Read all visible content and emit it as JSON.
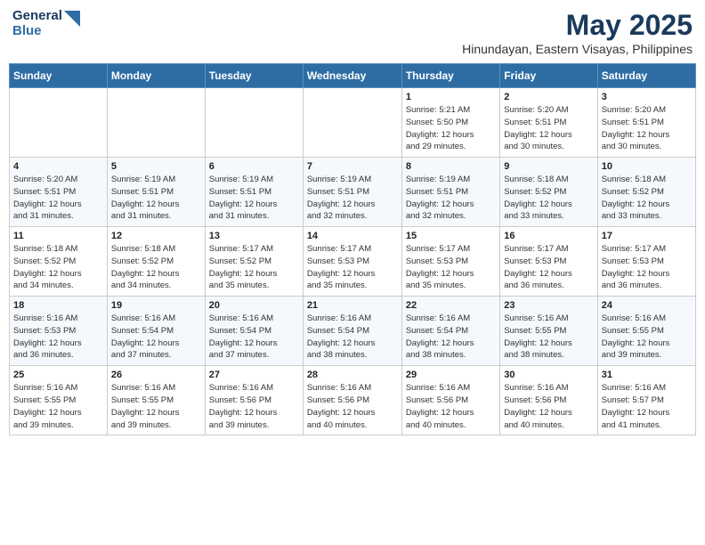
{
  "logo": {
    "line1": "General",
    "line2": "Blue"
  },
  "title": "May 2025",
  "subtitle": "Hinundayan, Eastern Visayas, Philippines",
  "days_header": [
    "Sunday",
    "Monday",
    "Tuesday",
    "Wednesday",
    "Thursday",
    "Friday",
    "Saturday"
  ],
  "weeks": [
    [
      {
        "day": "",
        "info": ""
      },
      {
        "day": "",
        "info": ""
      },
      {
        "day": "",
        "info": ""
      },
      {
        "day": "",
        "info": ""
      },
      {
        "day": "1",
        "info": "Sunrise: 5:21 AM\nSunset: 5:50 PM\nDaylight: 12 hours\nand 29 minutes."
      },
      {
        "day": "2",
        "info": "Sunrise: 5:20 AM\nSunset: 5:51 PM\nDaylight: 12 hours\nand 30 minutes."
      },
      {
        "day": "3",
        "info": "Sunrise: 5:20 AM\nSunset: 5:51 PM\nDaylight: 12 hours\nand 30 minutes."
      }
    ],
    [
      {
        "day": "4",
        "info": "Sunrise: 5:20 AM\nSunset: 5:51 PM\nDaylight: 12 hours\nand 31 minutes."
      },
      {
        "day": "5",
        "info": "Sunrise: 5:19 AM\nSunset: 5:51 PM\nDaylight: 12 hours\nand 31 minutes."
      },
      {
        "day": "6",
        "info": "Sunrise: 5:19 AM\nSunset: 5:51 PM\nDaylight: 12 hours\nand 31 minutes."
      },
      {
        "day": "7",
        "info": "Sunrise: 5:19 AM\nSunset: 5:51 PM\nDaylight: 12 hours\nand 32 minutes."
      },
      {
        "day": "8",
        "info": "Sunrise: 5:19 AM\nSunset: 5:51 PM\nDaylight: 12 hours\nand 32 minutes."
      },
      {
        "day": "9",
        "info": "Sunrise: 5:18 AM\nSunset: 5:52 PM\nDaylight: 12 hours\nand 33 minutes."
      },
      {
        "day": "10",
        "info": "Sunrise: 5:18 AM\nSunset: 5:52 PM\nDaylight: 12 hours\nand 33 minutes."
      }
    ],
    [
      {
        "day": "11",
        "info": "Sunrise: 5:18 AM\nSunset: 5:52 PM\nDaylight: 12 hours\nand 34 minutes."
      },
      {
        "day": "12",
        "info": "Sunrise: 5:18 AM\nSunset: 5:52 PM\nDaylight: 12 hours\nand 34 minutes."
      },
      {
        "day": "13",
        "info": "Sunrise: 5:17 AM\nSunset: 5:52 PM\nDaylight: 12 hours\nand 35 minutes."
      },
      {
        "day": "14",
        "info": "Sunrise: 5:17 AM\nSunset: 5:53 PM\nDaylight: 12 hours\nand 35 minutes."
      },
      {
        "day": "15",
        "info": "Sunrise: 5:17 AM\nSunset: 5:53 PM\nDaylight: 12 hours\nand 35 minutes."
      },
      {
        "day": "16",
        "info": "Sunrise: 5:17 AM\nSunset: 5:53 PM\nDaylight: 12 hours\nand 36 minutes."
      },
      {
        "day": "17",
        "info": "Sunrise: 5:17 AM\nSunset: 5:53 PM\nDaylight: 12 hours\nand 36 minutes."
      }
    ],
    [
      {
        "day": "18",
        "info": "Sunrise: 5:16 AM\nSunset: 5:53 PM\nDaylight: 12 hours\nand 36 minutes."
      },
      {
        "day": "19",
        "info": "Sunrise: 5:16 AM\nSunset: 5:54 PM\nDaylight: 12 hours\nand 37 minutes."
      },
      {
        "day": "20",
        "info": "Sunrise: 5:16 AM\nSunset: 5:54 PM\nDaylight: 12 hours\nand 37 minutes."
      },
      {
        "day": "21",
        "info": "Sunrise: 5:16 AM\nSunset: 5:54 PM\nDaylight: 12 hours\nand 38 minutes."
      },
      {
        "day": "22",
        "info": "Sunrise: 5:16 AM\nSunset: 5:54 PM\nDaylight: 12 hours\nand 38 minutes."
      },
      {
        "day": "23",
        "info": "Sunrise: 5:16 AM\nSunset: 5:55 PM\nDaylight: 12 hours\nand 38 minutes."
      },
      {
        "day": "24",
        "info": "Sunrise: 5:16 AM\nSunset: 5:55 PM\nDaylight: 12 hours\nand 39 minutes."
      }
    ],
    [
      {
        "day": "25",
        "info": "Sunrise: 5:16 AM\nSunset: 5:55 PM\nDaylight: 12 hours\nand 39 minutes."
      },
      {
        "day": "26",
        "info": "Sunrise: 5:16 AM\nSunset: 5:55 PM\nDaylight: 12 hours\nand 39 minutes."
      },
      {
        "day": "27",
        "info": "Sunrise: 5:16 AM\nSunset: 5:56 PM\nDaylight: 12 hours\nand 39 minutes."
      },
      {
        "day": "28",
        "info": "Sunrise: 5:16 AM\nSunset: 5:56 PM\nDaylight: 12 hours\nand 40 minutes."
      },
      {
        "day": "29",
        "info": "Sunrise: 5:16 AM\nSunset: 5:56 PM\nDaylight: 12 hours\nand 40 minutes."
      },
      {
        "day": "30",
        "info": "Sunrise: 5:16 AM\nSunset: 5:56 PM\nDaylight: 12 hours\nand 40 minutes."
      },
      {
        "day": "31",
        "info": "Sunrise: 5:16 AM\nSunset: 5:57 PM\nDaylight: 12 hours\nand 41 minutes."
      }
    ]
  ]
}
